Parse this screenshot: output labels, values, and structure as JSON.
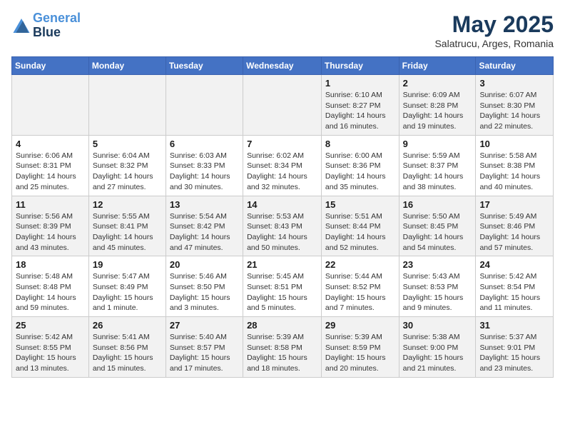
{
  "header": {
    "logo_line1": "General",
    "logo_line2": "Blue",
    "month": "May 2025",
    "location": "Salatrucu, Arges, Romania"
  },
  "days_of_week": [
    "Sunday",
    "Monday",
    "Tuesday",
    "Wednesday",
    "Thursday",
    "Friday",
    "Saturday"
  ],
  "weeks": [
    [
      {
        "day": "",
        "info": ""
      },
      {
        "day": "",
        "info": ""
      },
      {
        "day": "",
        "info": ""
      },
      {
        "day": "",
        "info": ""
      },
      {
        "day": "1",
        "info": "Sunrise: 6:10 AM\nSunset: 8:27 PM\nDaylight: 14 hours and 16 minutes."
      },
      {
        "day": "2",
        "info": "Sunrise: 6:09 AM\nSunset: 8:28 PM\nDaylight: 14 hours and 19 minutes."
      },
      {
        "day": "3",
        "info": "Sunrise: 6:07 AM\nSunset: 8:30 PM\nDaylight: 14 hours and 22 minutes."
      }
    ],
    [
      {
        "day": "4",
        "info": "Sunrise: 6:06 AM\nSunset: 8:31 PM\nDaylight: 14 hours and 25 minutes."
      },
      {
        "day": "5",
        "info": "Sunrise: 6:04 AM\nSunset: 8:32 PM\nDaylight: 14 hours and 27 minutes."
      },
      {
        "day": "6",
        "info": "Sunrise: 6:03 AM\nSunset: 8:33 PM\nDaylight: 14 hours and 30 minutes."
      },
      {
        "day": "7",
        "info": "Sunrise: 6:02 AM\nSunset: 8:34 PM\nDaylight: 14 hours and 32 minutes."
      },
      {
        "day": "8",
        "info": "Sunrise: 6:00 AM\nSunset: 8:36 PM\nDaylight: 14 hours and 35 minutes."
      },
      {
        "day": "9",
        "info": "Sunrise: 5:59 AM\nSunset: 8:37 PM\nDaylight: 14 hours and 38 minutes."
      },
      {
        "day": "10",
        "info": "Sunrise: 5:58 AM\nSunset: 8:38 PM\nDaylight: 14 hours and 40 minutes."
      }
    ],
    [
      {
        "day": "11",
        "info": "Sunrise: 5:56 AM\nSunset: 8:39 PM\nDaylight: 14 hours and 43 minutes."
      },
      {
        "day": "12",
        "info": "Sunrise: 5:55 AM\nSunset: 8:41 PM\nDaylight: 14 hours and 45 minutes."
      },
      {
        "day": "13",
        "info": "Sunrise: 5:54 AM\nSunset: 8:42 PM\nDaylight: 14 hours and 47 minutes."
      },
      {
        "day": "14",
        "info": "Sunrise: 5:53 AM\nSunset: 8:43 PM\nDaylight: 14 hours and 50 minutes."
      },
      {
        "day": "15",
        "info": "Sunrise: 5:51 AM\nSunset: 8:44 PM\nDaylight: 14 hours and 52 minutes."
      },
      {
        "day": "16",
        "info": "Sunrise: 5:50 AM\nSunset: 8:45 PM\nDaylight: 14 hours and 54 minutes."
      },
      {
        "day": "17",
        "info": "Sunrise: 5:49 AM\nSunset: 8:46 PM\nDaylight: 14 hours and 57 minutes."
      }
    ],
    [
      {
        "day": "18",
        "info": "Sunrise: 5:48 AM\nSunset: 8:48 PM\nDaylight: 14 hours and 59 minutes."
      },
      {
        "day": "19",
        "info": "Sunrise: 5:47 AM\nSunset: 8:49 PM\nDaylight: 15 hours and 1 minute."
      },
      {
        "day": "20",
        "info": "Sunrise: 5:46 AM\nSunset: 8:50 PM\nDaylight: 15 hours and 3 minutes."
      },
      {
        "day": "21",
        "info": "Sunrise: 5:45 AM\nSunset: 8:51 PM\nDaylight: 15 hours and 5 minutes."
      },
      {
        "day": "22",
        "info": "Sunrise: 5:44 AM\nSunset: 8:52 PM\nDaylight: 15 hours and 7 minutes."
      },
      {
        "day": "23",
        "info": "Sunrise: 5:43 AM\nSunset: 8:53 PM\nDaylight: 15 hours and 9 minutes."
      },
      {
        "day": "24",
        "info": "Sunrise: 5:42 AM\nSunset: 8:54 PM\nDaylight: 15 hours and 11 minutes."
      }
    ],
    [
      {
        "day": "25",
        "info": "Sunrise: 5:42 AM\nSunset: 8:55 PM\nDaylight: 15 hours and 13 minutes."
      },
      {
        "day": "26",
        "info": "Sunrise: 5:41 AM\nSunset: 8:56 PM\nDaylight: 15 hours and 15 minutes."
      },
      {
        "day": "27",
        "info": "Sunrise: 5:40 AM\nSunset: 8:57 PM\nDaylight: 15 hours and 17 minutes."
      },
      {
        "day": "28",
        "info": "Sunrise: 5:39 AM\nSunset: 8:58 PM\nDaylight: 15 hours and 18 minutes."
      },
      {
        "day": "29",
        "info": "Sunrise: 5:39 AM\nSunset: 8:59 PM\nDaylight: 15 hours and 20 minutes."
      },
      {
        "day": "30",
        "info": "Sunrise: 5:38 AM\nSunset: 9:00 PM\nDaylight: 15 hours and 21 minutes."
      },
      {
        "day": "31",
        "info": "Sunrise: 5:37 AM\nSunset: 9:01 PM\nDaylight: 15 hours and 23 minutes."
      }
    ]
  ]
}
